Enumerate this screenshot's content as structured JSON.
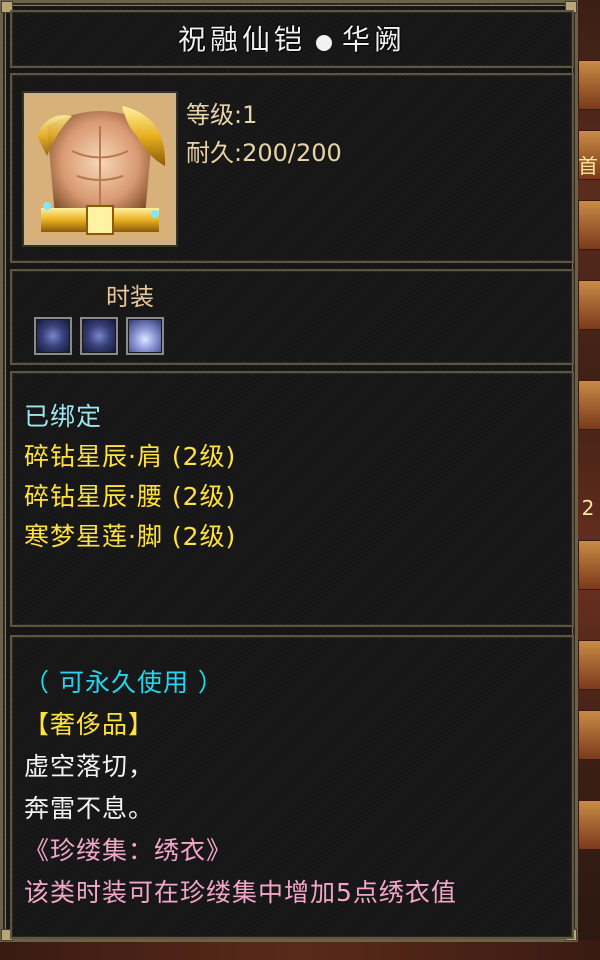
{
  "tooltip": {
    "title_left": "祝融仙铠",
    "title_right": "华阙",
    "level": "等级:1",
    "durability": "耐久:200/200",
    "fashion_label": "时装",
    "bound_status": "已绑定",
    "attributes": [
      "碎钻星辰·肩 (2级)",
      "碎钻星辰·腰 (2级)",
      "寒梦星莲·脚 (2级)"
    ],
    "permanent": "（ 可永久使用 ）",
    "luxury": "【奢侈品】",
    "poem": [
      "虚空落切，",
      "奔雷不息。"
    ],
    "collection_title": "《珍缕集：绣衣》",
    "collection_note": "该类时装可在珍缕集中增加5点绣衣值"
  },
  "side_strip": {
    "label_top": "首",
    "label_mid": "2"
  },
  "colors": {
    "stat_text": "#e8d3a6",
    "bound": "#9ce6f0",
    "attribute": "#ffe23a",
    "permanent": "#23d6ef",
    "collection": "#f2a6c8"
  },
  "icons": {
    "item_icon": "golden-armor-icon",
    "gem_slots": [
      "star-gem-icon",
      "star-gem-icon",
      "lotus-gem-icon"
    ]
  }
}
